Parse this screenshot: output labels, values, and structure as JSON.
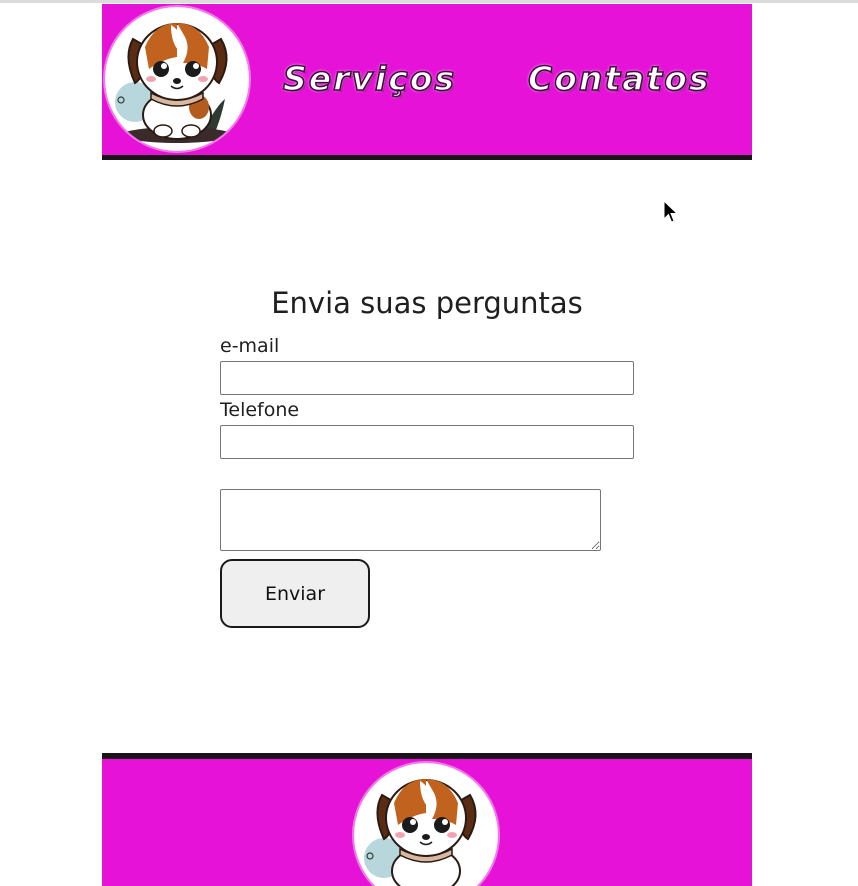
{
  "header": {
    "logo_icon": "puppy-logo-icon",
    "nav": {
      "servicos_label": "Serviços",
      "contatos_label": "Contatos"
    }
  },
  "form": {
    "title": "Envia suas perguntas",
    "email_label": "e-mail",
    "email_value": "",
    "phone_label": "Telefone",
    "phone_value": "",
    "message_value": "",
    "submit_label": "Enviar"
  },
  "footer": {
    "logo_icon": "puppy-logo-icon"
  },
  "colors": {
    "brand_magenta": "#e612d8",
    "border_dark": "#1a1418"
  }
}
